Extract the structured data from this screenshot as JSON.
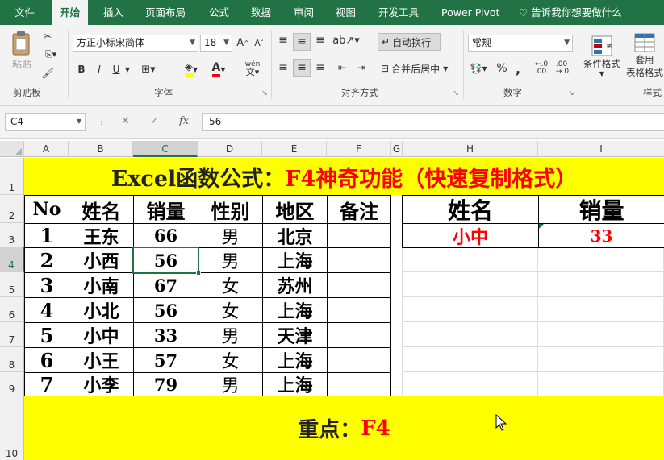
{
  "tabs": {
    "file": "文件",
    "home": "开始",
    "insert": "插入",
    "layout": "页面布局",
    "formulas": "公式",
    "data": "数据",
    "review": "审阅",
    "view": "视图",
    "developer": "开发工具",
    "powerpivot": "Power Pivot",
    "tellme": "告诉我你想要做什么"
  },
  "ribbon": {
    "paste_label": "粘贴",
    "clipboard_group": "剪贴板",
    "font_name": "方正小标宋简体",
    "font_size": "18",
    "bold": "B",
    "italic": "I",
    "underline": "U",
    "font_group": "字体",
    "wen": "wén",
    "wrap_text": "自动换行",
    "merge_center": "合并后居中",
    "align_group": "对齐方式",
    "number_format": "常规",
    "number_group": "数字",
    "cond_format": "条件格式",
    "table_format_1": "套用",
    "table_format_2": "表格格式",
    "style_group": "样式",
    "percent": "%",
    "comma": ","
  },
  "formula_bar": {
    "cell_ref": "C4",
    "fx": "fx",
    "value": "56"
  },
  "columns": [
    "A",
    "B",
    "C",
    "D",
    "E",
    "F",
    "G",
    "H",
    "I"
  ],
  "rows": [
    "1",
    "2",
    "3",
    "4",
    "5",
    "6",
    "7",
    "8",
    "9",
    "10"
  ],
  "sheet": {
    "title_black": "Excel函数公式：",
    "title_red": "F4神奇功能（快速复制格式）",
    "headers": [
      "No",
      "姓名",
      "销量",
      "性别",
      "地区",
      "备注"
    ],
    "records": [
      [
        "1",
        "王东",
        "66",
        "男",
        "北京",
        ""
      ],
      [
        "2",
        "小西",
        "56",
        "男",
        "上海",
        ""
      ],
      [
        "3",
        "小南",
        "67",
        "女",
        "苏州",
        ""
      ],
      [
        "4",
        "小北",
        "56",
        "女",
        "上海",
        ""
      ],
      [
        "5",
        "小中",
        "33",
        "男",
        "天津",
        ""
      ],
      [
        "6",
        "小王",
        "57",
        "女",
        "上海",
        ""
      ],
      [
        "7",
        "小李",
        "79",
        "男",
        "上海",
        ""
      ]
    ],
    "lookup_headers": [
      "姓名",
      "销量"
    ],
    "lookup_values": [
      "小中",
      "33"
    ],
    "bottom_black": "重点：",
    "bottom_red": "F4"
  },
  "colors": {
    "ribbon_green": "#217346",
    "highlight_yellow": "#ffff00",
    "accent_red": "#ff0000"
  }
}
